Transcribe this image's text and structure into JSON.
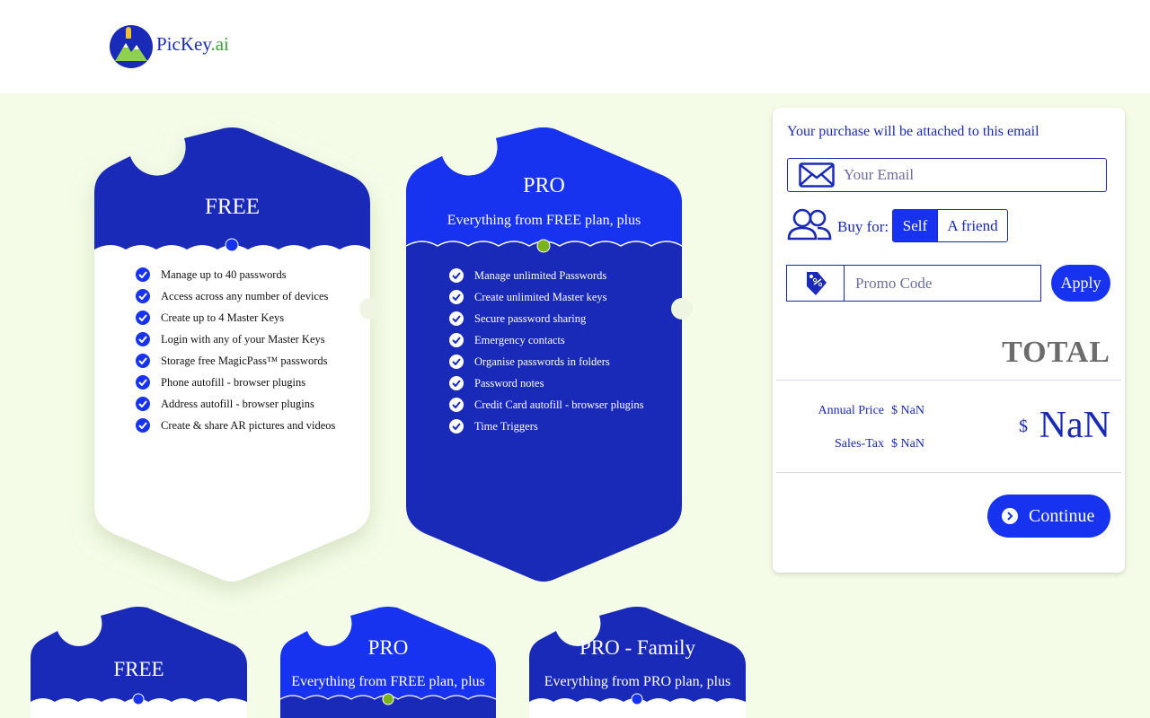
{
  "brand": {
    "name_main": "PicKey",
    "name_suffix": ".ai"
  },
  "colors": {
    "primary": "#1a2ab8",
    "accent": "#1833f0",
    "background": "#f4fce8",
    "dot_pro": "#7ab31a"
  },
  "plans": {
    "free": {
      "title": "FREE",
      "features": [
        "Manage up to 40 passwords",
        "Access across any number of devices",
        "Create up to 4 Master Keys",
        "Login with any of your Master Keys",
        "Storage free MagicPass™ passwords",
        "Phone autofill - browser plugins",
        "Address autofill - browser plugins",
        "Create & share AR pictures and videos"
      ]
    },
    "pro": {
      "title": "PRO",
      "subtitle": "Everything from FREE plan, plus",
      "features": [
        "Manage unlimited Passwords",
        "Create unlimited Master keys",
        "Secure password sharing",
        "Emergency contacts",
        "Organise passwords in folders",
        "Password notes",
        "Credit Card autofill - browser plugins",
        "Time Triggers"
      ]
    },
    "small": [
      {
        "title": "FREE",
        "subtitle": ""
      },
      {
        "title": "PRO",
        "subtitle": "Everything from FREE plan, plus"
      },
      {
        "title": "PRO - Family",
        "subtitle": "Everything from PRO plan, plus"
      }
    ]
  },
  "checkout": {
    "email_label": "Your purchase will be attached to this email",
    "email_placeholder": "Your Email",
    "buy_for_label": "Buy for:",
    "buy_for_options": [
      "Self",
      "A friend"
    ],
    "buy_for_selected": "Self",
    "promo_placeholder": "Promo Code",
    "apply_label": "Apply",
    "total_title": "TOTAL",
    "annual_price_label": "Annual Price",
    "annual_price_value": "$ NaN",
    "sales_tax_label": "Sales-Tax",
    "sales_tax_value": "$ NaN",
    "total_currency": "$",
    "total_value": "NaN",
    "continue_label": "Continue"
  }
}
